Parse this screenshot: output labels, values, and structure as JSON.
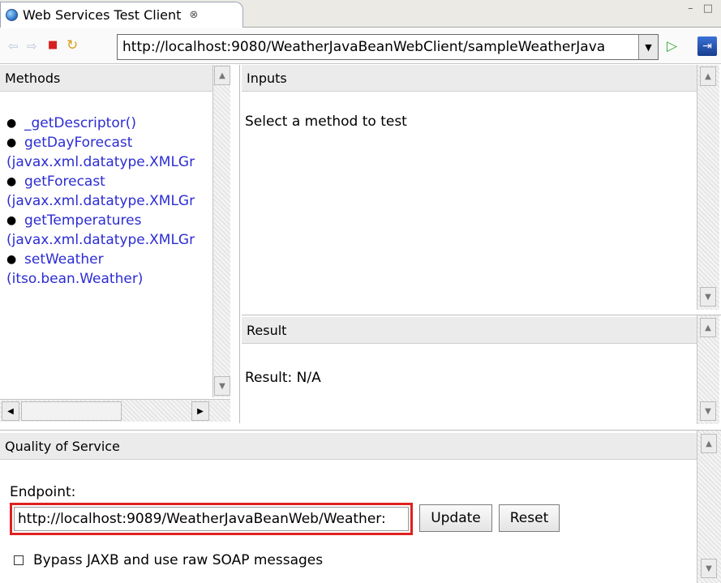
{
  "tab": {
    "title": "Web Services Test Client",
    "close_symbol": "⊗"
  },
  "window_controls": "– □",
  "toolbar": {
    "url": "http://localhost:9080/WeatherJavaBeanWebClient/sampleWeatherJava",
    "back_icon": "⇦",
    "forward_icon": "⇨",
    "stop_icon": "■",
    "refresh_icon": "↻",
    "dropdown_icon": "▼",
    "go_icon": "▷",
    "external_icon": "⇥"
  },
  "methods": {
    "header": "Methods",
    "items": [
      {
        "line1": "_getDescriptor()",
        "line2": ""
      },
      {
        "line1": "getDayForecast",
        "line2": "(javax.xml.datatype.XMLGr"
      },
      {
        "line1": "getForecast",
        "line2": "(javax.xml.datatype.XMLGr"
      },
      {
        "line1": "getTemperatures",
        "line2": "(javax.xml.datatype.XMLGr"
      },
      {
        "line1": "setWeather",
        "line2": "(itso.bean.Weather)"
      }
    ]
  },
  "inputs": {
    "header": "Inputs",
    "message": "Select a method to test"
  },
  "result": {
    "header": "Result",
    "text": "Result: N/A"
  },
  "qos": {
    "header": "Quality of Service",
    "endpoint_label": "Endpoint:",
    "endpoint_value": "http://localhost:9089/WeatherJavaBeanWeb/Weather:",
    "update_label": "Update",
    "reset_label": "Reset",
    "bypass_label": "Bypass JAXB and use raw SOAP messages"
  },
  "colors": {
    "link": "#2c2cd3",
    "highlight": "#e02020",
    "header_bg": "#ebebeb"
  }
}
